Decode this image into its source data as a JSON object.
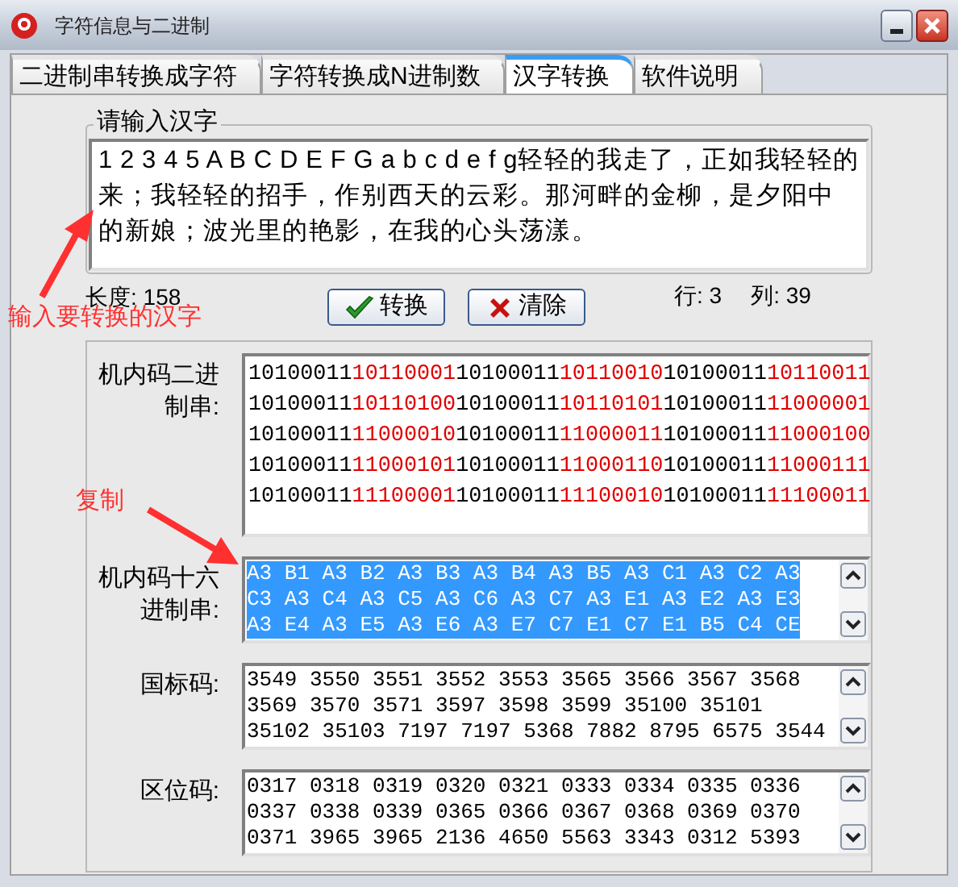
{
  "window": {
    "title": "字符信息与二进制"
  },
  "tabs": [
    {
      "label": "二进制串转换成字符",
      "selected": false
    },
    {
      "label": "字符转换成N进制数",
      "selected": false
    },
    {
      "label": "汉字转换",
      "selected": true
    },
    {
      "label": "软件说明",
      "selected": false
    }
  ],
  "input_group": {
    "title": "请输入汉字",
    "text": "1 2 3 4 5 A B C D E F G a b c d e f g轻轻的我走了，正如我轻轻的来；我轻轻的招手，作别西天的云彩。那河畔的金柳，是夕阳中的新娘；波光里的艳影，在我的心头荡漾。"
  },
  "length_label": "长度: 158",
  "buttons": [
    {
      "kind": "convert",
      "label": "转换"
    },
    {
      "kind": "clear",
      "label": "清除"
    }
  ],
  "row_label": "行: 3",
  "col_label": "列: 39",
  "outputs": [
    {
      "kind": "binary",
      "label": "机内码二进制串:",
      "rows": [
        [
          {
            "text": "10100011",
            "highlighted": false
          },
          {
            "text": "10110001",
            "highlighted": true
          },
          {
            "text": "10100011",
            "highlighted": false
          },
          {
            "text": "10110010",
            "highlighted": true
          },
          {
            "text": "10100011",
            "highlighted": false
          },
          {
            "text": "10110011",
            "highlighted": true
          }
        ],
        [
          {
            "text": "10100011",
            "highlighted": false
          },
          {
            "text": "10110100",
            "highlighted": true
          },
          {
            "text": "10100011",
            "highlighted": false
          },
          {
            "text": "10110101",
            "highlighted": true
          },
          {
            "text": "10100011",
            "highlighted": false
          },
          {
            "text": "11000001",
            "highlighted": true
          }
        ],
        [
          {
            "text": "10100011",
            "highlighted": false
          },
          {
            "text": "11000010",
            "highlighted": true
          },
          {
            "text": "10100011",
            "highlighted": false
          },
          {
            "text": "11000011",
            "highlighted": true
          },
          {
            "text": "10100011",
            "highlighted": false
          },
          {
            "text": "11000100",
            "highlighted": true
          }
        ],
        [
          {
            "text": "10100011",
            "highlighted": false
          },
          {
            "text": "11000101",
            "highlighted": true
          },
          {
            "text": "10100011",
            "highlighted": false
          },
          {
            "text": "11000110",
            "highlighted": true
          },
          {
            "text": "10100011",
            "highlighted": false
          },
          {
            "text": "11000111",
            "highlighted": true
          }
        ],
        [
          {
            "text": "10100011",
            "highlighted": false
          },
          {
            "text": "11100001",
            "highlighted": true
          },
          {
            "text": "10100011",
            "highlighted": false
          },
          {
            "text": "11100010",
            "highlighted": true
          },
          {
            "text": "10100011",
            "highlighted": false
          },
          {
            "text": "11100011",
            "highlighted": true
          }
        ]
      ]
    },
    {
      "kind": "text",
      "label": "机内码十六进制串:",
      "selected": true,
      "lines": [
        "A3 B1 A3 B2 A3 B3 A3 B4 A3 B5 A3 C1 A3 C2 A3",
        "C3 A3 C4 A3 C5 A3 C6 A3 C7 A3 E1 A3 E2 A3 E3",
        "A3 E4 A3 E5 A3 E6 A3 E7 C7 E1 C7 E1 B5 C4 CE"
      ]
    },
    {
      "kind": "text",
      "label": "国标码:",
      "selected": false,
      "lines": [
        "3549 3550 3551 3552 3553 3565 3566 3567 3568",
        "3569 3570 3571 3597 3598 3599 35100 35101",
        "35102 35103 7197 7197 5368 7882 8795 6575 3544"
      ]
    },
    {
      "kind": "text",
      "label": "区位码:",
      "selected": false,
      "lines": [
        "0317 0318 0319 0320 0321 0333 0334 0335 0336",
        "0337 0338 0339 0365 0366 0367 0368 0369 0370",
        "0371 3965 3965 2136 4650 5563 3343 0312 5393"
      ]
    }
  ],
  "annotations": [
    {
      "text": "输入要转换的汉字"
    },
    {
      "text": "复制"
    }
  ]
}
